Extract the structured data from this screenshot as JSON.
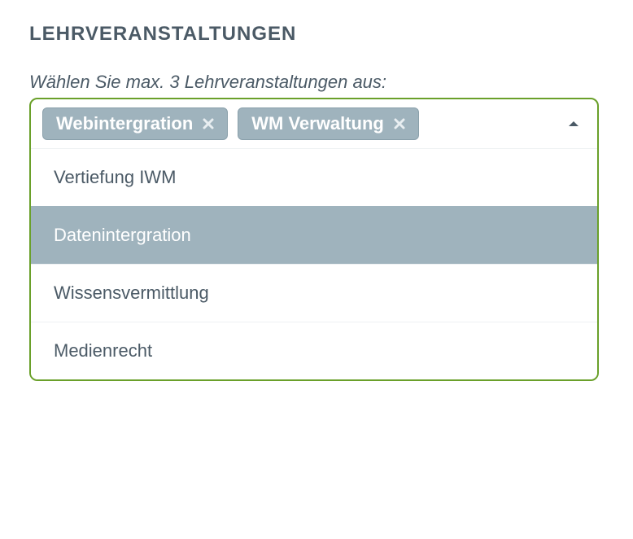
{
  "heading": "LEHRVERANSTALTUNGEN",
  "prompt": "Wählen Sie max. 3 Lehrveranstaltungen aus:",
  "selected": [
    {
      "label": "Webintergration"
    },
    {
      "label": "WM Verwaltung"
    }
  ],
  "options": [
    {
      "label": "Vertiefung IWM",
      "highlighted": false
    },
    {
      "label": "Datenintergration",
      "highlighted": true
    },
    {
      "label": "Wissensvermittlung",
      "highlighted": false
    },
    {
      "label": "Medienrecht",
      "highlighted": false
    }
  ],
  "colors": {
    "border": "#6aa02a",
    "tag_bg": "#9fb3bd",
    "text": "#4b5a66"
  }
}
